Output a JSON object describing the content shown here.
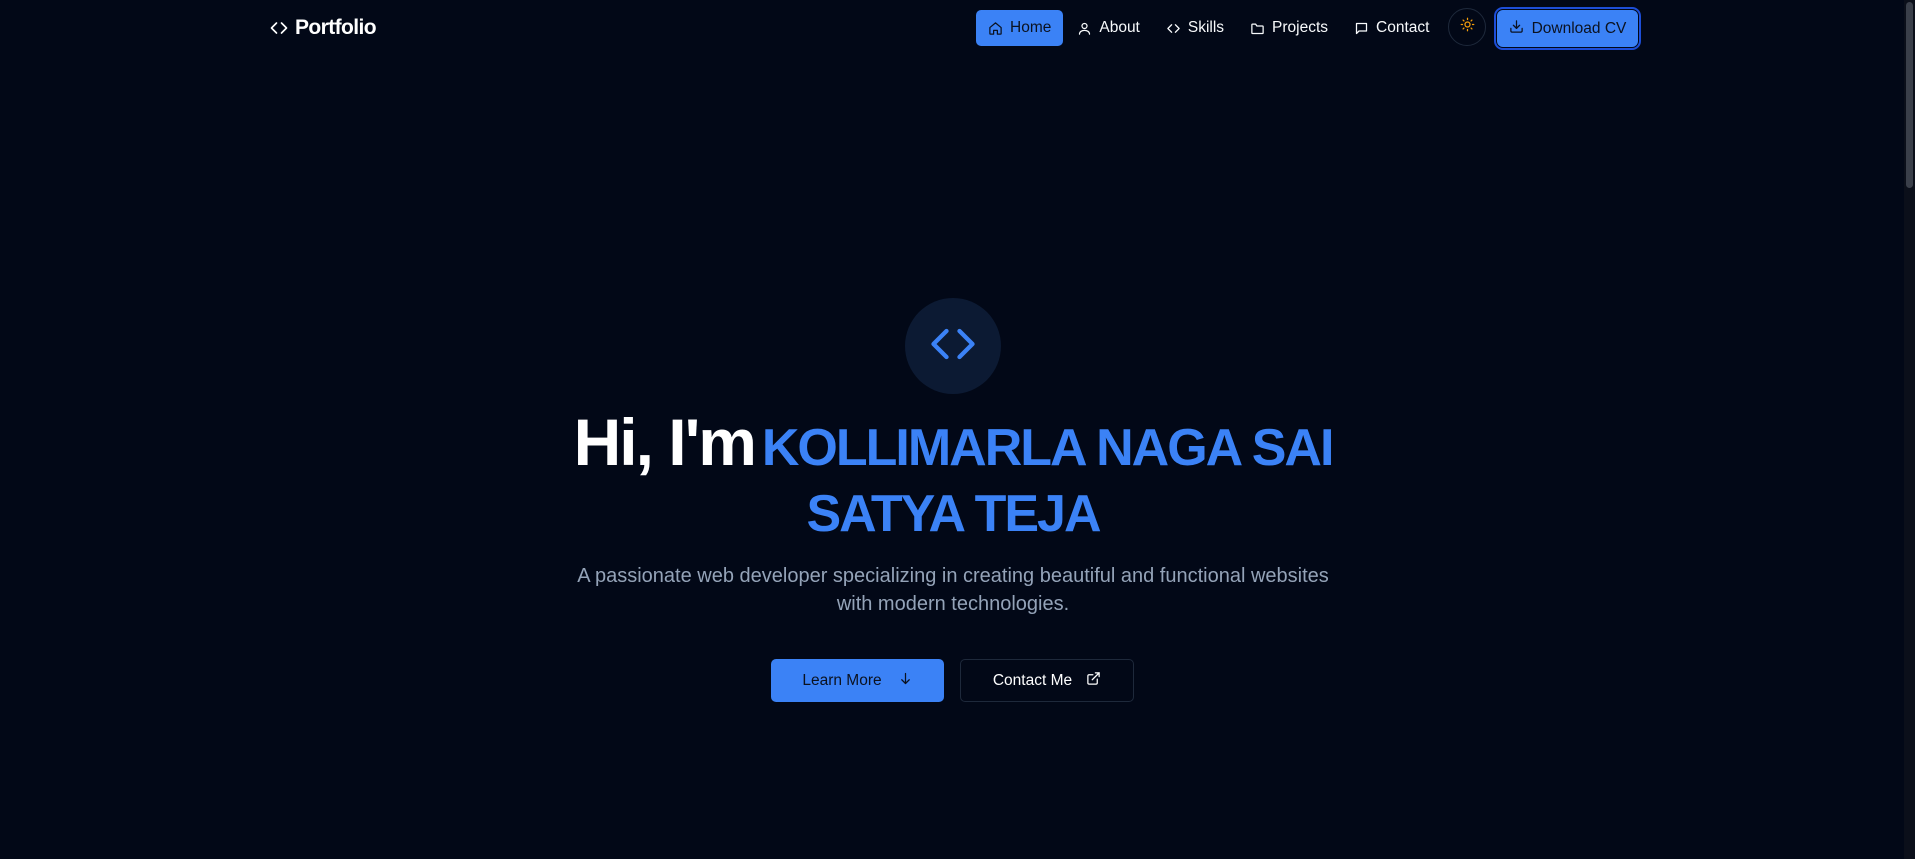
{
  "header": {
    "brand": "Portfolio",
    "nav": [
      {
        "label": "Home",
        "icon": "home-icon",
        "active": true
      },
      {
        "label": "About",
        "icon": "user-icon"
      },
      {
        "label": "Skills",
        "icon": "code-icon"
      },
      {
        "label": "Projects",
        "icon": "folder-icon"
      },
      {
        "label": "Contact",
        "icon": "message-icon"
      }
    ],
    "theme_toggle_icon": "sun-icon",
    "download_cv_label": "Download CV"
  },
  "hero": {
    "icon": "code-icon",
    "greeting": "Hi, I'm",
    "name": "KOLLIMARLA NAGA SAI SATYA TEJA",
    "subtitle": "A passionate web developer specializing in creating beautiful and functional websites with modern technologies.",
    "primary_button": "Learn More",
    "secondary_button": "Contact Me"
  },
  "colors": {
    "background": "#020817",
    "accent": "#3b82f6",
    "muted_text": "#94a3b8",
    "sun": "#f59e0b"
  }
}
